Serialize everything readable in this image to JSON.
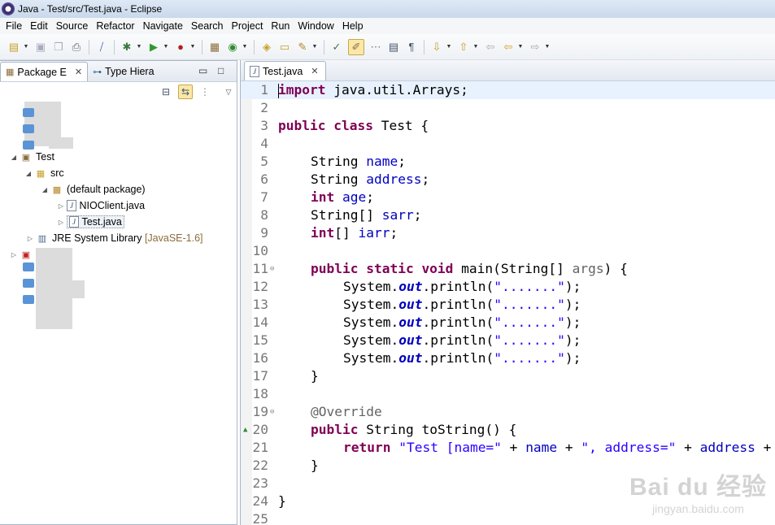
{
  "window": {
    "title": "Java - Test/src/Test.java - Eclipse"
  },
  "menubar": [
    "File",
    "Edit",
    "Source",
    "Refactor",
    "Navigate",
    "Search",
    "Project",
    "Run",
    "Window",
    "Help"
  ],
  "left_panel": {
    "tab_package": "Package E",
    "tab_type": "Type Hiera",
    "tree": {
      "project": "Test",
      "src": "src",
      "package": "(default package)",
      "file1": "NIOClient.java",
      "file2": "Test.java",
      "jre": "JRE System Library",
      "jre_version": "[JavaSE-1.6]"
    }
  },
  "editor": {
    "tab": "Test.java",
    "lines": [
      {
        "n": "1"
      },
      {
        "n": "2"
      },
      {
        "n": "3"
      },
      {
        "n": "4"
      },
      {
        "n": "5"
      },
      {
        "n": "6"
      },
      {
        "n": "7"
      },
      {
        "n": "8"
      },
      {
        "n": "9"
      },
      {
        "n": "10"
      },
      {
        "n": "11"
      },
      {
        "n": "12"
      },
      {
        "n": "13"
      },
      {
        "n": "14"
      },
      {
        "n": "15"
      },
      {
        "n": "16"
      },
      {
        "n": "17"
      },
      {
        "n": "18"
      },
      {
        "n": "19"
      },
      {
        "n": "20"
      },
      {
        "n": "21"
      },
      {
        "n": "22"
      },
      {
        "n": "23"
      },
      {
        "n": "24"
      },
      {
        "n": "25"
      }
    ],
    "code": {
      "l1_kw": "import",
      "l1_rest": " java.util.Arrays;",
      "l3_kw": "public class",
      "l3_rest": " Test {",
      "l5_type": "String ",
      "l5_field": "name",
      "l5_end": ";",
      "l6_type": "String ",
      "l6_field": "address",
      "l6_end": ";",
      "l7_kw": "int",
      "l7_field": "age",
      "l7_end": ";",
      "l8_type": "String[] ",
      "l8_field": "sarr",
      "l8_end": ";",
      "l9_kw": "int",
      "l9_mid": "[] ",
      "l9_field": "iarr",
      "l9_end": ";",
      "l11_kw": "public static void",
      "l11_rest": " main(String[] ",
      "l11_param": "args",
      "l11_end": ") {",
      "println_pre": "System.",
      "println_out": "out",
      "println_mid": ".println(",
      "println_str": "\".......\"",
      "println_end": ");",
      "close_brace": "}",
      "l19_ann": "@Override",
      "l20_kw": "public",
      "l20_rest": " String toString() {",
      "l21_kw": "return",
      "l21_s1": "\"Test [name=\"",
      "l21_p1": " + ",
      "l21_f1": "name",
      "l21_p2": " + ",
      "l21_s2": "\", address=\"",
      "l21_p3": " + ",
      "l21_f2": "address",
      "l21_p4": " +"
    }
  },
  "watermark": {
    "line1": "Bai du 经验",
    "line2": "jingyan.baidu.com"
  }
}
